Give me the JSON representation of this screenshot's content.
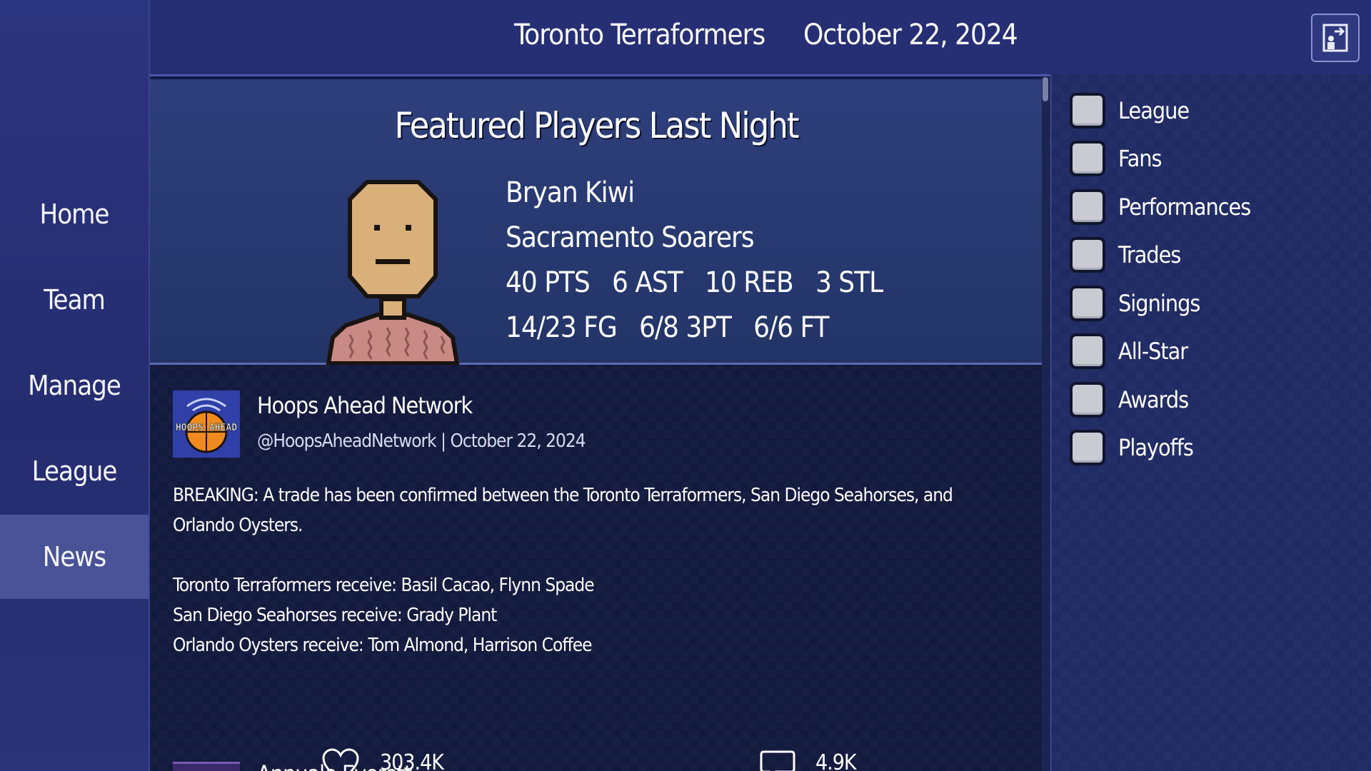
{
  "header": {
    "team": "Toronto Terraformers",
    "date": "October 22, 2024"
  },
  "sidebar": {
    "items": [
      {
        "label": "Home"
      },
      {
        "label": "Team"
      },
      {
        "label": "Manage"
      },
      {
        "label": "League"
      },
      {
        "label": "News",
        "active": true
      }
    ]
  },
  "featured": {
    "title": "Featured Players Last Night",
    "player_name": "Bryan Kiwi",
    "player_team": "Sacramento Soarers",
    "stats_line1": "40 PTS   6 AST   10 REB   3 STL",
    "stats_line2": "14/23 FG   6/8 3PT   6/6 FT"
  },
  "post": {
    "avatar_text": "HOOPS AHEAD",
    "author": "Hoops Ahead Network",
    "meta": "@HoopsAheadNetwork | October 22, 2024",
    "body_lines": [
      "BREAKING: A trade has been confirmed between the Toronto Terraformers, San Diego Seahorses, and",
      "Orlando Oysters.",
      "Toronto Terraformers receive: Basil Cacao, Flynn Spade",
      "San Diego Seahorses receive: Grady Plant",
      "Orlando Oysters receive: Tom Almond, Harrison Coffee"
    ],
    "likes": "303.4K",
    "comments": "4.9K"
  },
  "post2": {
    "author": "Annuale Everett"
  },
  "filters": {
    "items": [
      {
        "label": "League"
      },
      {
        "label": "Fans"
      },
      {
        "label": "Performances"
      },
      {
        "label": "Trades"
      },
      {
        "label": "Signings"
      },
      {
        "label": "All-Star"
      },
      {
        "label": "Awards"
      },
      {
        "label": "Playoffs"
      }
    ]
  },
  "icons": {
    "exit": "exit-door-icon",
    "like": "heart-icon",
    "comment": "speech-bubble-icon"
  },
  "colors": {
    "sidebar": "#2b347e",
    "active_nav": "#4a5398",
    "topbar": "#262f73",
    "featured_bg": "#2e3f7c",
    "checkbox": "#c9cbd3"
  }
}
